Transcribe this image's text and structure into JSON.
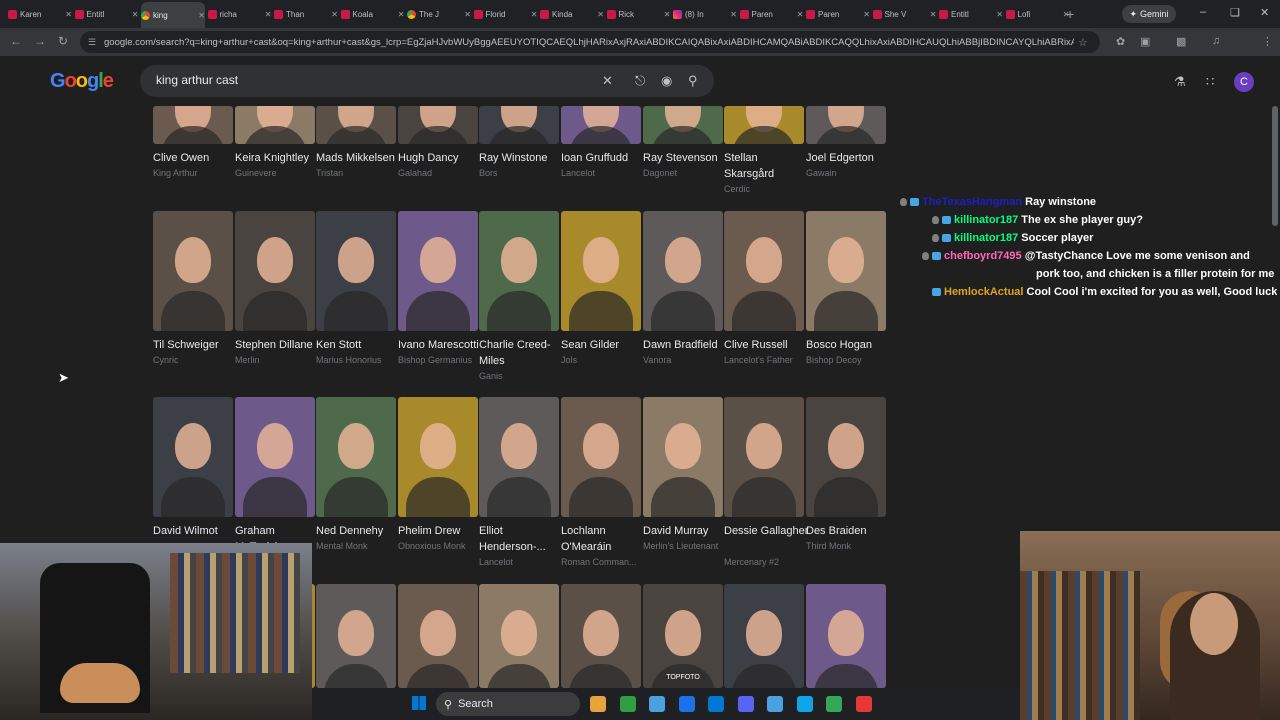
{
  "browser": {
    "tabs": [
      {
        "label": "Karen",
        "kind": "youtube"
      },
      {
        "label": "Entitl",
        "kind": "youtube"
      },
      {
        "label": "king",
        "kind": "chrome",
        "active": true
      },
      {
        "label": "richa",
        "kind": "youtube"
      },
      {
        "label": "Than",
        "kind": "youtube"
      },
      {
        "label": "Koala",
        "kind": "youtube"
      },
      {
        "label": "The J",
        "kind": "chrome"
      },
      {
        "label": "Florid",
        "kind": "youtube"
      },
      {
        "label": "Kinda",
        "kind": "youtube"
      },
      {
        "label": "Rick",
        "kind": "youtube"
      },
      {
        "label": "(8) In",
        "kind": "insta"
      },
      {
        "label": "Paren",
        "kind": "youtube"
      },
      {
        "label": "Paren",
        "kind": "youtube"
      },
      {
        "label": "She V",
        "kind": "youtube"
      },
      {
        "label": "Entitl",
        "kind": "youtube"
      },
      {
        "label": "Lofi",
        "kind": "youtube"
      }
    ],
    "gemini_label": "Gemini",
    "url": "google.com/search?q=king+arthur+cast&oq=king+arthur+cast&gs_lcrp=EgZjaHJvbWUyBggAEEUYOTIQCAEQLhjHARixAxjRAxiABDIKCAIQABixAxiABDIHCAMQABiABDIKCAQQLhixAxiABDIHCAUQLhiABBjIBDINCAYQLhiABRixAxiABDIKCA...",
    "profile_initial": "C"
  },
  "google": {
    "logo": [
      "G",
      "o",
      "o",
      "g",
      "l",
      "e"
    ],
    "query": "king arthur cast",
    "avatar_initial": "C"
  },
  "cast_rows": [
    [
      {
        "name": "Clive Owen",
        "role": "King Arthur"
      },
      {
        "name": "Keira Knightley",
        "role": "Guinevere"
      },
      {
        "name": "Mads Mikkelsen",
        "role": "Tristan"
      },
      {
        "name": "Hugh Dancy",
        "role": "Galahad"
      },
      {
        "name": "Ray Winstone",
        "role": "Bors"
      },
      {
        "name": "Ioan Gruffudd",
        "role": "Lancelot"
      },
      {
        "name": "Ray Stevenson",
        "role": "Dagonet"
      },
      {
        "name": "Stellan Skarsgård",
        "role": "Cerdic"
      },
      {
        "name": "Joel Edgerton",
        "role": "Gawain"
      }
    ],
    [
      {
        "name": "Til Schweiger",
        "role": "Cynric"
      },
      {
        "name": "Stephen Dillane",
        "role": "Merlin"
      },
      {
        "name": "Ken Stott",
        "role": "Marius Honorius"
      },
      {
        "name": "Ivano Marescotti",
        "role": "Bishop Germanius"
      },
      {
        "name": "Charlie Creed-Miles",
        "role": "Ganis"
      },
      {
        "name": "Sean Gilder",
        "role": "Jols"
      },
      {
        "name": "Dawn Bradfield",
        "role": "Vanora"
      },
      {
        "name": "Clive Russell",
        "role": "Lancelot's Father"
      },
      {
        "name": "Bosco Hogan",
        "role": "Bishop Decoy"
      }
    ],
    [
      {
        "name": "David Wilmot",
        "role": ""
      },
      {
        "name": "Graham McTavish",
        "role": ""
      },
      {
        "name": "Ned Dennehy",
        "role": "Mental Monk"
      },
      {
        "name": "Phelim Drew",
        "role": "Obnoxious Monk"
      },
      {
        "name": "Elliot Henderson-...",
        "role": "Lancelot"
      },
      {
        "name": "Lochlann O'Mearáin",
        "role": "Roman Comman..."
      },
      {
        "name": "David Murray",
        "role": "Merlin's Lieutenant"
      },
      {
        "name": "Dessie Gallagher",
        "role": "Mercenary #2"
      },
      {
        "name": "Des Braiden",
        "role": "Third Monk"
      }
    ],
    [
      {
        "name": "",
        "role": ""
      },
      {
        "name": "",
        "role": ""
      },
      {
        "name": "",
        "role": ""
      },
      {
        "name": "",
        "role": ""
      },
      {
        "name": "",
        "role": ""
      },
      {
        "name": "",
        "role": ""
      },
      {
        "name": "",
        "role": ""
      },
      {
        "name": "",
        "role": ""
      },
      {
        "name": "",
        "role": ""
      }
    ]
  ],
  "photo_colors": [
    "#6b5a4e",
    "#8a7a66",
    "#5a5048",
    "#4a4440",
    "#3d3f46",
    "#6e5a8a",
    "#4f6a4a",
    "#a88a2a",
    "#5e5a5a"
  ],
  "watermark": "TOPFOTO",
  "chat": [
    {
      "user": "TheTexasHangman",
      "color": "#1e1ec8",
      "message": "Ray winstone",
      "mod": true,
      "sub": true
    },
    {
      "user": "killinator187",
      "color": "#00ff7f",
      "message": "The ex she player guy?",
      "mod": true,
      "sub": true,
      "indent": true
    },
    {
      "user": "killinator187",
      "color": "#00ff7f",
      "message": "Soccer player",
      "mod": true,
      "sub": true,
      "indent": true
    },
    {
      "user": "chefboyrd7495",
      "color": "#ff69b4",
      "message": "@TastyChance Love me some venison and",
      "message2": "pork too, and chicken is a filler protein for me",
      "mod": true,
      "sub": true,
      "indent": true
    },
    {
      "user": "HemlockActual",
      "color": "#daa520",
      "message": "Cool Cool i'm excited for you as well, Good luck",
      "sub": true,
      "indent": true
    }
  ],
  "taskbar": {
    "search_label": "Search",
    "icons": [
      "#e8a33d",
      "#2ea043",
      "#4aa3df",
      "#1a73e8",
      "#0078d4",
      "#5865f2",
      "#4aa3df",
      "#0ea5e9",
      "#34a853",
      "#e53935"
    ]
  }
}
